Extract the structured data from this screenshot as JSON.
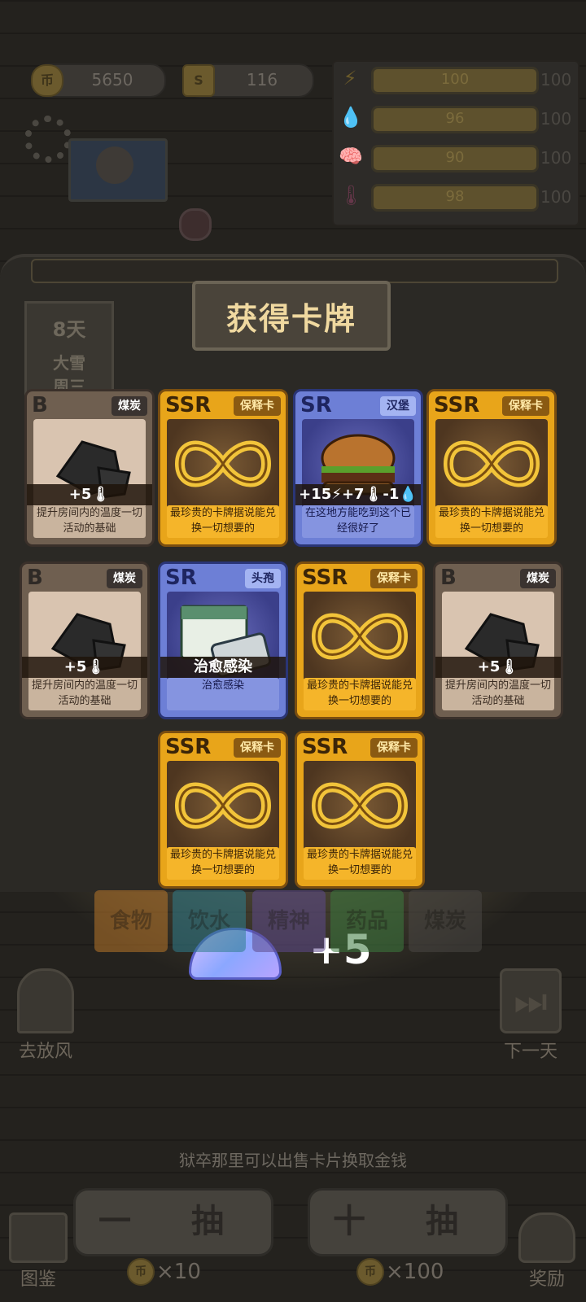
{
  "hud": {
    "coins": "5650",
    "tokens": "116",
    "stats": [
      {
        "icon": "energy-icon",
        "value": "100",
        "max": "100",
        "color": "#f1c232"
      },
      {
        "icon": "water-icon",
        "value": "96",
        "max": "100",
        "color": "#4aa3e0"
      },
      {
        "icon": "brain-icon",
        "value": "90",
        "max": "100",
        "color": "#8a6fd1"
      },
      {
        "icon": "temperature-icon",
        "value": "98",
        "max": "100",
        "color": "#e06a8a"
      }
    ]
  },
  "calendar": {
    "day": "8天",
    "weather": "大雪",
    "weekday": "周三"
  },
  "dialog": {
    "title": "获得卡牌",
    "cards": [
      {
        "rarity": "B",
        "tag": "煤炭",
        "effect": "+5🌡",
        "desc": "提升房间内的温度一切活动的基础",
        "art": "coal"
      },
      {
        "rarity": "SSR",
        "tag": "保释卡",
        "effect": "",
        "desc": "最珍贵的卡牌据说能兑换一切想要的",
        "art": "infinity"
      },
      {
        "rarity": "SR",
        "tag": "汉堡",
        "effect": "+15⚡+7🌡-1💧",
        "desc": "在这地方能吃到这个已经很好了",
        "art": "burger"
      },
      {
        "rarity": "SSR",
        "tag": "保释卡",
        "effect": "",
        "desc": "最珍贵的卡牌据说能兑换一切想要的",
        "art": "infinity"
      },
      {
        "rarity": "B",
        "tag": "煤炭",
        "effect": "+5🌡",
        "desc": "提升房间内的温度一切活动的基础",
        "art": "coal"
      },
      {
        "rarity": "SR",
        "tag": "头孢",
        "effect": "治愈感染",
        "desc": "治愈感染",
        "art": "medicine"
      },
      {
        "rarity": "SSR",
        "tag": "保释卡",
        "effect": "",
        "desc": "最珍贵的卡牌据说能兑换一切想要的",
        "art": "infinity"
      },
      {
        "rarity": "B",
        "tag": "煤炭",
        "effect": "+5🌡",
        "desc": "提升房间内的温度一切活动的基础",
        "art": "coal"
      },
      {
        "rarity": "SSR",
        "tag": "保释卡",
        "effect": "",
        "desc": "最珍贵的卡牌据说能兑换一切想要的",
        "art": "infinity"
      },
      {
        "rarity": "SSR",
        "tag": "保释卡",
        "effect": "",
        "desc": "最珍贵的卡牌据说能兑换一切想要的",
        "art": "infinity"
      }
    ],
    "reward": "+5"
  },
  "tabs": [
    {
      "label": "食物",
      "color": "#b8762a"
    },
    {
      "label": "饮水",
      "color": "#2f7d8c"
    },
    {
      "label": "精神",
      "color": "#5e4a8c"
    },
    {
      "label": "药品",
      "color": "#3c7a3e"
    },
    {
      "label": "煤炭",
      "color": "#4a4744"
    }
  ],
  "side": {
    "left": "去放风",
    "right": "下一天"
  },
  "hint": "狱卒那里可以出售卡片换取金钱",
  "bottom": {
    "guide": "图鉴",
    "single": "一 抽",
    "ten": "十 抽",
    "single_cost": "×10",
    "ten_cost": "×100",
    "reward": "奖励"
  }
}
